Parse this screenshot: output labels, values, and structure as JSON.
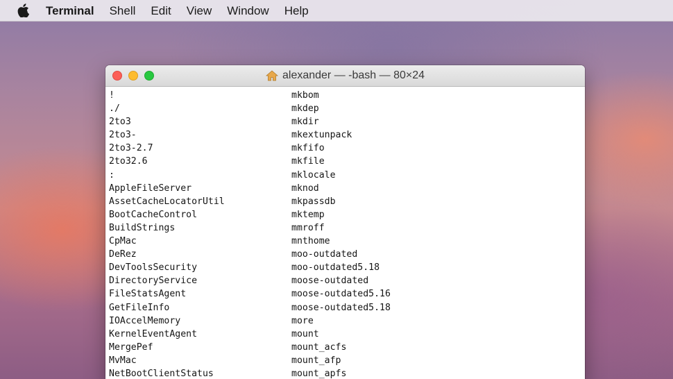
{
  "menubar": {
    "apple_icon": "apple-logo-icon",
    "items": [
      "Terminal",
      "Shell",
      "Edit",
      "View",
      "Window",
      "Help"
    ]
  },
  "window": {
    "title": "alexander — -bash — 80×24",
    "title_icon": "home-folder-icon",
    "traffic_colors": {
      "close": "#fc5f57",
      "minimize": "#fdbc2e",
      "zoom": "#28c840"
    }
  },
  "terminal": {
    "rows": [
      [
        "!",
        "mkbom"
      ],
      [
        "./",
        "mkdep"
      ],
      [
        "2to3",
        "mkdir"
      ],
      [
        "2to3-",
        "mkextunpack"
      ],
      [
        "2to3-2.7",
        "mkfifo"
      ],
      [
        "2to32.6",
        "mkfile"
      ],
      [
        ":",
        "mklocale"
      ],
      [
        "AppleFileServer",
        "mknod"
      ],
      [
        "AssetCacheLocatorUtil",
        "mkpassdb"
      ],
      [
        "BootCacheControl",
        "mktemp"
      ],
      [
        "BuildStrings",
        "mmroff"
      ],
      [
        "CpMac",
        "mnthome"
      ],
      [
        "DeRez",
        "moo-outdated"
      ],
      [
        "DevToolsSecurity",
        "moo-outdated5.18"
      ],
      [
        "DirectoryService",
        "moose-outdated"
      ],
      [
        "FileStatsAgent",
        "moose-outdated5.16"
      ],
      [
        "GetFileInfo",
        "moose-outdated5.18"
      ],
      [
        "IOAccelMemory",
        "more"
      ],
      [
        "KernelEventAgent",
        "mount"
      ],
      [
        "MergePef",
        "mount_acfs"
      ],
      [
        "MvMac",
        "mount_afp"
      ],
      [
        "NetBootClientStatus",
        "mount_apfs"
      ]
    ]
  }
}
